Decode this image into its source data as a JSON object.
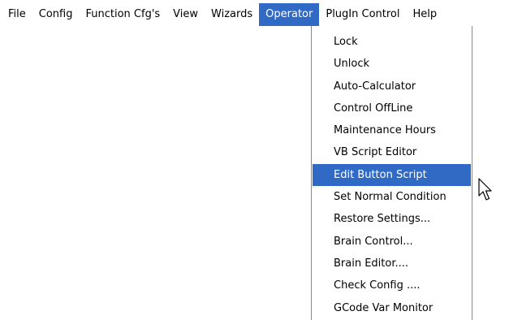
{
  "menubar": {
    "items": [
      "File",
      "Config",
      "Function Cfg's",
      "View",
      "Wizards",
      "Operator",
      "PlugIn Control",
      "Help"
    ],
    "active_index": 5
  },
  "operator_menu": {
    "items": [
      "Lock",
      "Unlock",
      "Auto-Calculator",
      "Control OffLine",
      "Maintenance Hours",
      "VB Script Editor",
      "Edit Button Script",
      "Set Normal Condition",
      "Restore Settings...",
      "Brain Control...",
      "Brain Editor....",
      "Check Config ....",
      "GCode Var Monitor"
    ],
    "highlighted_index": 6
  },
  "colors": {
    "highlight": "#316ac5",
    "highlight_text": "#ffffff",
    "menu_border": "#8a8a8a"
  }
}
